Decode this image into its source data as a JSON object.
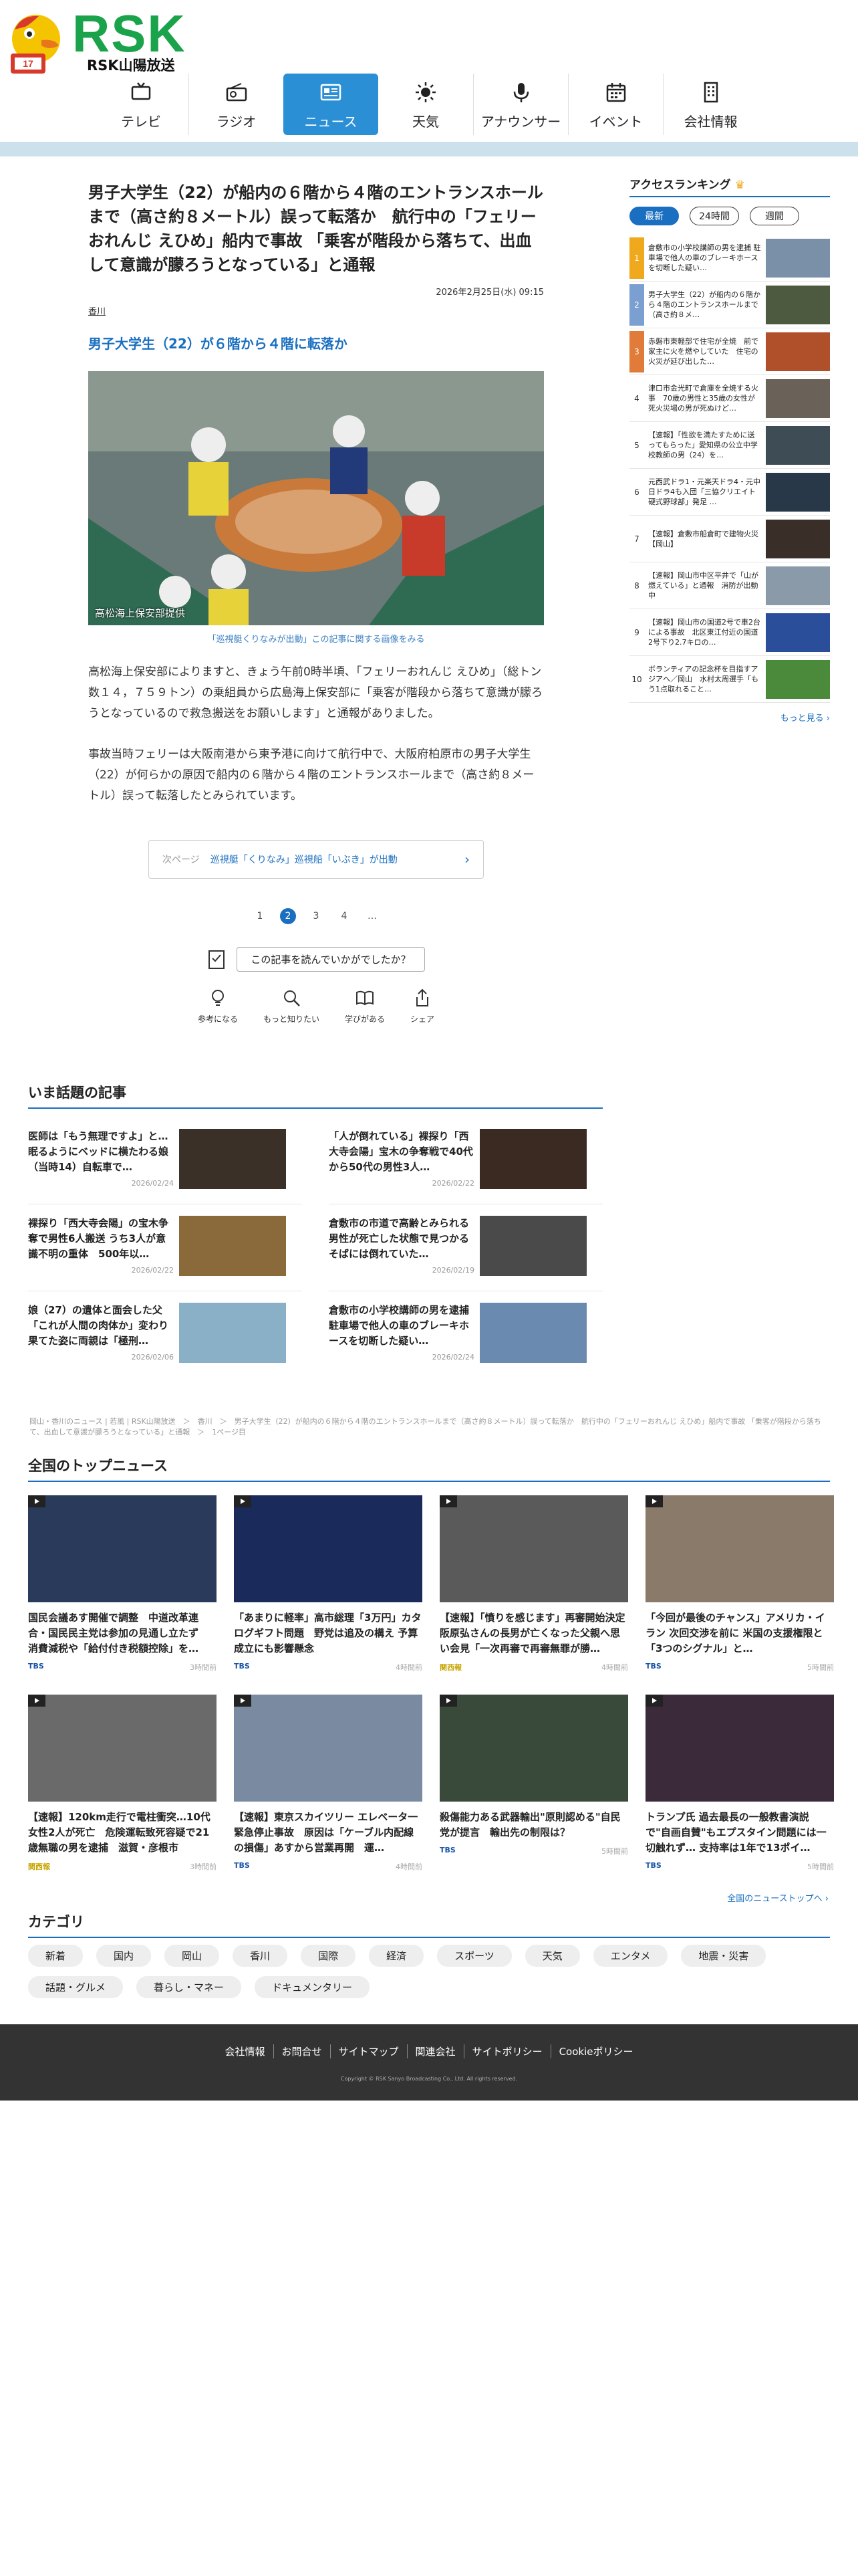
{
  "header": {
    "logo_text": "RSK",
    "logo_sub": "RSK山陽放送",
    "nav": [
      {
        "label": "テレビ",
        "icon": "tv-icon"
      },
      {
        "label": "ラジオ",
        "icon": "radio-icon"
      },
      {
        "label": "ニュース",
        "icon": "news-icon",
        "active": true
      },
      {
        "label": "天気",
        "icon": "sun-icon"
      },
      {
        "label": "アナウンサー",
        "icon": "microphone-icon"
      },
      {
        "label": "イベント",
        "icon": "calendar-icon"
      },
      {
        "label": "会社情報",
        "icon": "building-icon"
      }
    ]
  },
  "article": {
    "headline": "男子大学生（22）が船内の６階から４階のエントランスホールまで（高さ約８メートル）誤って転落か　航行中の「フェリーおれんじ えひめ」船内で事故 「乗客が階段から落ちて、出血して意識が朦ろうとなっている」と通報",
    "date": "2026年2月25日(水) 09:15",
    "tag": "香川",
    "subhead": "男子大学生（22）が６階から４階に転落か",
    "photo_caption": "高松海上保安部提供",
    "photo_link": "「巡視艇くりなみが出動」この記事に関する画像をみる",
    "para1": "高松海上保安部によりますと、きょう午前0時半頃、「フェリーおれんじ えひめ」（総トン数１４，７５９トン）の乗組員から広島海上保安部に「乗客が階段から落ちて意識が朦ろうとなっているので救急搬送をお願いします」と通報がありました。",
    "para2": "事故当時フェリーは大阪南港から東予港に向けて航行中で、大阪府柏原市の男子大学生（22）が何らかの原因で船内の６階から４階のエントランスホールまで（高さ約８メートル）誤って転落したとみられています。",
    "next_label": "次ページ",
    "next_text": "巡視艇「くりなみ」巡視船「いぶき」が出動",
    "pages": [
      "1",
      "2",
      "3",
      "4",
      "…"
    ],
    "feedback": "この記事を読んでいかがでしたか？",
    "reactions": [
      {
        "label": "参考になる",
        "icon": "lightbulb-icon"
      },
      {
        "label": "もっと知りたい",
        "icon": "search-icon"
      },
      {
        "label": "学びがある",
        "icon": "book-icon"
      },
      {
        "label": "シェア",
        "icon": "share-icon"
      }
    ]
  },
  "ranking": {
    "title": "アクセスランキング",
    "tabs": [
      "最新",
      "24時間",
      "週間"
    ],
    "items": [
      {
        "num": "1",
        "text": "倉敷市の小学校講師の男を逮捕 駐車場で他人の車のブレーキホースを切断した疑い…",
        "color": "#7a8fa8"
      },
      {
        "num": "2",
        "text": "男子大学生（22）が船内の６階から４階のエントランスホールまで（高さ約８メ…",
        "color": "#4d5a40"
      },
      {
        "num": "3",
        "text": "赤磐市東軽部で住宅が全焼　前で家主に火を燃やしていた　住宅の火災が延び出した…",
        "color": "#b0502a"
      },
      {
        "num": "4",
        "text": "津口市金光町で倉庫を全焼する火事　70歳の男性と35歳の女性が死火災場の男が死ぬけど…",
        "color": "#6a6258"
      },
      {
        "num": "5",
        "text": "【速報】「性欲を満たすために送ってもらった」愛知県の公立中学校教師の男（24）を…",
        "color": "#3d4c55"
      },
      {
        "num": "6",
        "text": "元西武ドラ1・元楽天ドラ4・元中日ドラ4も入団「三協クリエイト硬式野球部」発足 …",
        "color": "#283848"
      },
      {
        "num": "7",
        "text": "【速報】倉敷市船倉町で建物火災【岡山】",
        "color": "#3a2e28"
      },
      {
        "num": "8",
        "text": "【速報】岡山市中区平井で「山が燃えている」と通報　消防が出動中",
        "color": "#8a9aa8"
      },
      {
        "num": "9",
        "text": "【速報】岡山市の国道2号で車2台による事故　北区東江付近の国道2号下り2.7キロの…",
        "color": "#2a4e9a"
      },
      {
        "num": "10",
        "text": "ボランティアの記念杯を目指すアジアへ／岡山　水村太周選手「もう1点取れること…",
        "color": "#4a8a3a"
      }
    ],
    "more": "もっと見る"
  },
  "trending": {
    "title": "いま話題の記事",
    "items": [
      {
        "title": "医師は「もう無理ですよ」と…眠るようにベッドに横たわる娘（当時14）自転車で…",
        "date": "2026/02/24",
        "color": "#3a3028"
      },
      {
        "title": "「人が倒れている」裸探り「西大寺会陽」宝木の争奪戦で40代から50代の男性3人…",
        "date": "2026/02/22",
        "color": "#3a2a22"
      },
      {
        "title": "裸探り「西大寺会陽」の宝木争奪で男性6人搬送 うち3人が意識不明の重体　500年以…",
        "date": "2026/02/22",
        "color": "#8a6a3a"
      },
      {
        "title": "倉敷市の市道で高齢とみられる男性が死亡した状態で見つかる　そばには倒れていた…",
        "date": "2026/02/19",
        "color": "#4a4a4a"
      },
      {
        "title": "娘（27）の遺体と面会した父「これが人間の肉体か」変わり果てた姿に両親は「極刑…",
        "date": "2026/02/06",
        "color": "#8ab0c8"
      },
      {
        "title": "倉敷市の小学校講師の男を逮捕　駐車場で他人の車のブレーキホースを切断した疑い…",
        "date": "2026/02/24",
        "color": "#6a8ab0"
      }
    ]
  },
  "breadcrumb": "岡山・香川のニュース | 若風 | RSK山陽放送　＞　香川　＞　男子大学生（22）が船内の６階から４階のエントランスホールまで（高さ約８メートル）誤って転落か　航行中の「フェリーおれんじ えひめ」船内で事故 「乗客が階段から落ちて、出血して意識が朦ろうとなっている」と通報　＞　1ページ目",
  "top_news": {
    "title": "全国のトップニュース",
    "items": [
      {
        "title": "国民会議あす開催で調整　中道改革連合・国民民主党は参加の見通し立たず　消費減税や「給付付き税額控除」を…",
        "src": "TBS",
        "time": "3時間前",
        "color": "#2a3a5a"
      },
      {
        "title": "「あまりに軽率」高市総理「3万円」カタログギフト問題　野党は追及の構え 予算成立にも影響懸念",
        "src": "TBS",
        "time": "4時間前",
        "color": "#1a2a5a"
      },
      {
        "title": "【速報】「憤りを感じます」再審開始決定　阪原弘さんの長男が亡くなった父親へ思い会見「一次再審で再審無罪が勝…",
        "src": "関西報",
        "time": "4時間前",
        "color": "#5a5a5a"
      },
      {
        "title": "「今回が最後のチャンス」アメリカ・イラン 次回交渉を前に 米国の支援権限と「3つのシグナル」と…",
        "src": "TBS",
        "time": "5時間前",
        "color": "#8a7a6a"
      },
      {
        "title": "【速報】120km走行で電柱衝突…10代女性2人が死亡　危険運転致死容疑で21歳無職の男を逮捕　滋賀・彦根市",
        "src": "関西報",
        "time": "3時間前",
        "color": "#6a6a6a"
      },
      {
        "title": "【速報】東京スカイツリー エレベータ一緊急停止事故　原因は「ケーブル内配線の損傷」あすから営業再開　運…",
        "src": "TBS",
        "time": "4時間前",
        "color": "#7a8aa0"
      },
      {
        "title": "殺傷能力ある武器輸出\"原則認める\"自民党が提言　輸出先の制限は？",
        "src": "TBS",
        "time": "5時間前",
        "color": "#3a4a3a"
      },
      {
        "title": "トランプ氏 過去最長の一般教書演説で\"自画自賛\"もエプスタイン問題には一切触れず… 支持率は1年で13ポイ…",
        "src": "TBS",
        "time": "5時間前",
        "color": "#3a2a3a"
      }
    ],
    "more": "全国のニューストップへ"
  },
  "categories": {
    "title": "カテゴリ",
    "items": [
      "新着",
      "国内",
      "岡山",
      "香川",
      "国際",
      "経済",
      "スポーツ",
      "天気",
      "エンタメ",
      "地震・災害",
      "話題・グルメ",
      "暮らし・マネー",
      "ドキュメンタリー"
    ]
  },
  "footer": {
    "links": [
      "会社情報",
      "お問合せ",
      "サイトマップ",
      "関連会社",
      "サイトポリシー",
      "Cookieポリシー"
    ],
    "copyright": "Copyright © RSK Sanyo Broadcasting Co., Ltd. All rights reserved."
  }
}
